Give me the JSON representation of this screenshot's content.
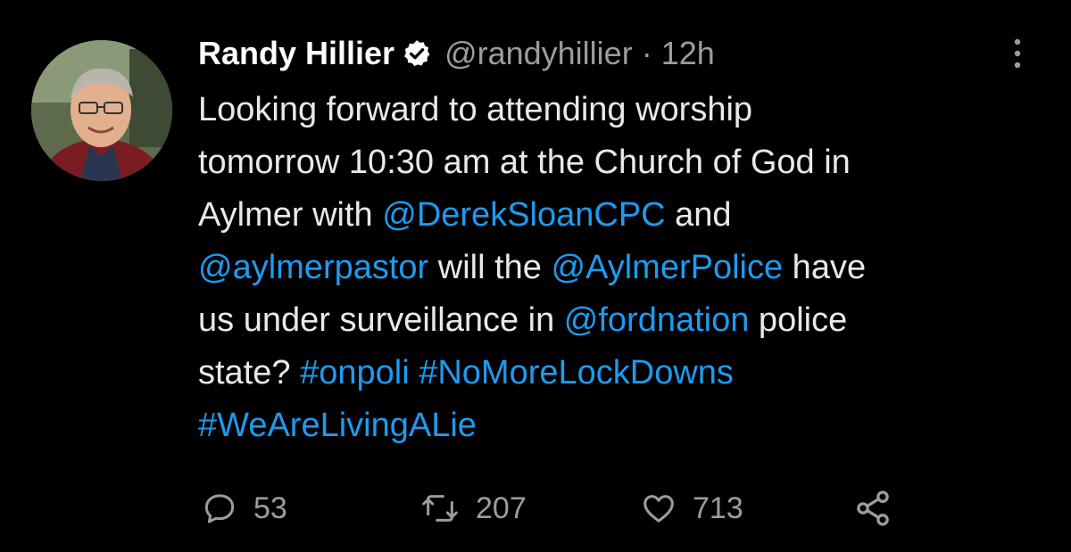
{
  "author": {
    "display_name": "Randy Hillier",
    "handle": "@randyhillier",
    "separator": "·",
    "time": "12h",
    "verified_icon": "verified-badge-icon",
    "avatar_icon": "profile-photo"
  },
  "tweet": {
    "lines": [
      [
        {
          "t": "Looking forward to attending worship"
        }
      ],
      [
        {
          "t": "tomorrow 10:30 am at the Church of God in"
        }
      ],
      [
        {
          "t": "Aylmer with "
        },
        {
          "t": "@DerekSloanCPC",
          "link": true
        },
        {
          "t": " and"
        }
      ],
      [
        {
          "t": "@aylmerpastor",
          "link": true
        },
        {
          "t": " will the "
        },
        {
          "t": "@AylmerPolice",
          "link": true
        },
        {
          "t": " have"
        }
      ],
      [
        {
          "t": "us under surveillance in "
        },
        {
          "t": "@fordnation",
          "link": true
        },
        {
          "t": " police"
        }
      ],
      [
        {
          "t": "state? "
        },
        {
          "t": "#onpoli",
          "link": true
        },
        {
          "t": " "
        },
        {
          "t": "#NoMoreLockDowns",
          "link": true
        }
      ],
      [
        {
          "t": "#WeAreLivingALie",
          "link": true
        }
      ]
    ]
  },
  "actions": {
    "reply": {
      "icon": "reply-icon",
      "count": "53"
    },
    "retweet": {
      "icon": "retweet-icon",
      "count": "207"
    },
    "like": {
      "icon": "heart-icon",
      "count": "713"
    },
    "share": {
      "icon": "share-icon"
    }
  },
  "menu": {
    "icon": "more-options-icon"
  },
  "colors": {
    "background": "#000000",
    "text": "#e7e9ea",
    "secondary": "#9a9da1",
    "link": "#1d9bf0"
  }
}
